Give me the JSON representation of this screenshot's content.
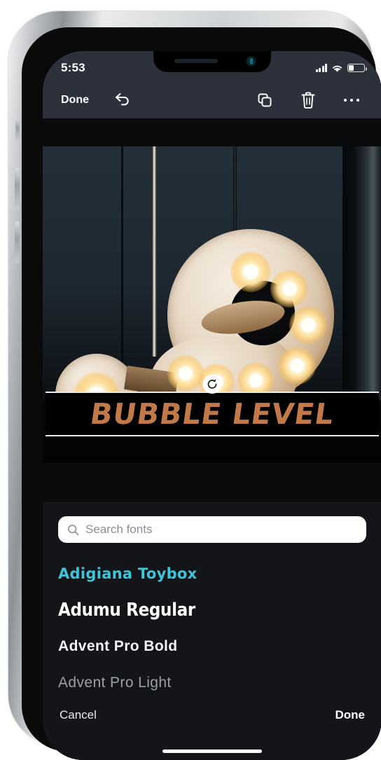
{
  "status_bar": {
    "time": "5:53",
    "signal_icon": "cellular-bars-icon",
    "wifi_icon": "wifi-icon",
    "battery_icon": "battery-low-icon"
  },
  "toolbar": {
    "done_label": "Done",
    "undo_icon": "undo-arrow-icon",
    "duplicate_icon": "duplicate-layers-icon",
    "delete_icon": "trash-icon",
    "more_icon": "more-ellipsis-icon"
  },
  "canvas": {
    "photo_description": "marquee-letter-lightbulbs-photo",
    "text_element": {
      "value": "BUBBLE LEVEL",
      "color": "#c2794a",
      "rotate_handle_icon": "rotate-handle-icon"
    }
  },
  "font_picker": {
    "search": {
      "placeholder": "Search fonts",
      "value": "",
      "search_icon": "search-icon"
    },
    "fonts": [
      {
        "label": "Adigiana Toybox",
        "color": "#3fc4d8",
        "style": "fs-toybox"
      },
      {
        "label": "Adumu Regular",
        "color": "#ffffff",
        "style": "fs-adumu"
      },
      {
        "label": "Advent Pro Bold",
        "color": "#f2f4f6",
        "style": "fs-advbold"
      },
      {
        "label": "Advent Pro Light",
        "color": "#9aa0a6",
        "style": "fs-advlight"
      }
    ],
    "cancel_label": "Cancel",
    "done_label": "Done"
  },
  "colors": {
    "toolbar_bg": "#2c313c",
    "sheet_bg": "#131519",
    "accent_teal": "#3fc4d8",
    "text_orange": "#c2794a"
  }
}
